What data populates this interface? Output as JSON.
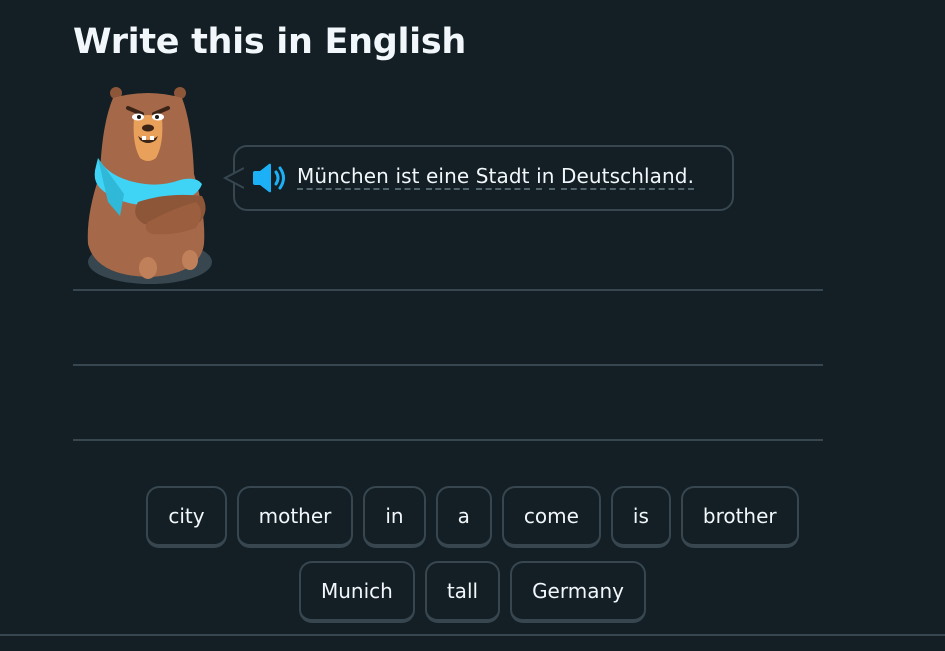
{
  "challenge": {
    "title": "Write this in English"
  },
  "prompt": {
    "speaker_icon": "speaker-icon",
    "sentence": [
      "München",
      "ist",
      "eine",
      "Stadt",
      "in",
      "Deutschland."
    ]
  },
  "word_bank": {
    "row1": [
      "city",
      "mother",
      "in",
      "a",
      "come",
      "is",
      "brother"
    ],
    "row2": [
      "Munich",
      "tall",
      "Germany"
    ]
  },
  "colors": {
    "background": "#131f24",
    "border": "#37464f",
    "text": "#f1f7fb",
    "speaker": "#1cb0f6",
    "bear": "#a5694a",
    "scarf": "#3fd3f5"
  }
}
